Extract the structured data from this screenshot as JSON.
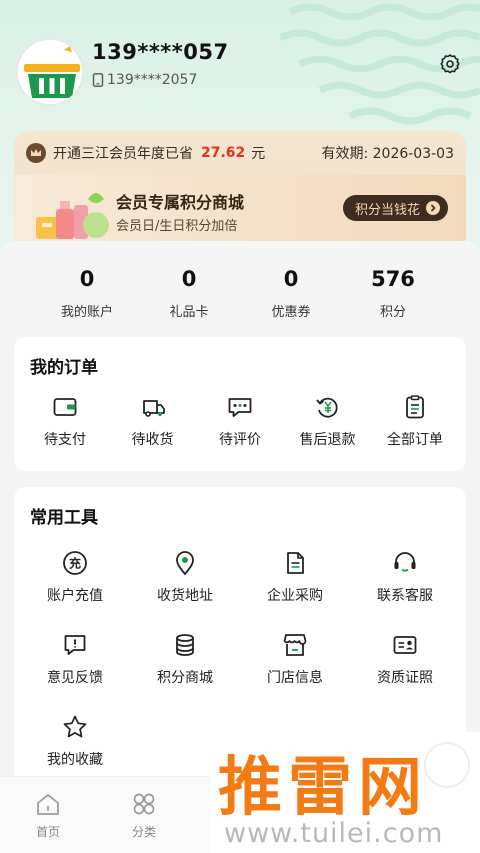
{
  "profile": {
    "phone": "139****057",
    "sub_phone": "139****2057"
  },
  "member": {
    "prefix": "开通三江会员年度已省",
    "amount": "27.62",
    "unit": "元",
    "valid_label": "有效期:",
    "valid_date": "2026-03-03",
    "shop_title": "会员专属积分商城",
    "shop_sub": "会员日/生日积分加倍",
    "shop_button": "积分当钱花"
  },
  "stats": [
    {
      "value": "0",
      "label": "我的账户"
    },
    {
      "value": "0",
      "label": "礼品卡"
    },
    {
      "value": "0",
      "label": "优惠券"
    },
    {
      "value": "576",
      "label": "积分"
    }
  ],
  "orders": {
    "title": "我的订单",
    "items": [
      {
        "label": "待支付",
        "icon": "wallet-icon"
      },
      {
        "label": "待收货",
        "icon": "delivery-icon"
      },
      {
        "label": "待评价",
        "icon": "comment-icon"
      },
      {
        "label": "售后退款",
        "icon": "refund-icon"
      },
      {
        "label": "全部订单",
        "icon": "clipboard-icon"
      }
    ]
  },
  "tools": {
    "title": "常用工具",
    "items": [
      {
        "label": "账户充值",
        "icon": "recharge-icon",
        "glyph": "充"
      },
      {
        "label": "收货地址",
        "icon": "location-icon"
      },
      {
        "label": "企业采购",
        "icon": "document-icon"
      },
      {
        "label": "联系客服",
        "icon": "headset-icon"
      },
      {
        "label": "意见反馈",
        "icon": "feedback-icon"
      },
      {
        "label": "积分商城",
        "icon": "coins-icon"
      },
      {
        "label": "门店信息",
        "icon": "store-icon"
      },
      {
        "label": "资质证照",
        "icon": "license-icon"
      },
      {
        "label": "我的收藏",
        "icon": "star-icon"
      }
    ]
  },
  "tabbar": [
    {
      "label": "首页",
      "icon": "home-icon"
    },
    {
      "label": "分类",
      "icon": "category-icon"
    }
  ],
  "watermark": {
    "title": "推雷网",
    "url": "www.tuilei.com"
  },
  "colors": {
    "accent": "#1c9a4a",
    "save_red": "#e0341c",
    "gold_dark": "#3d2c20"
  }
}
